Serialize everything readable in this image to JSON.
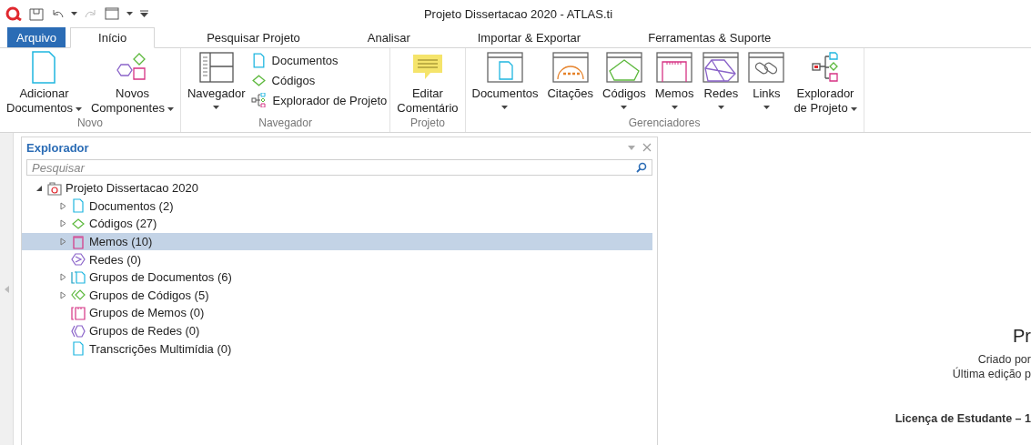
{
  "window": {
    "title": "Projeto Dissertacao 2020 - ATLAS.ti"
  },
  "tabs": [
    {
      "label": "Arquivo",
      "kind": "file",
      "selected": false
    },
    {
      "label": "Início",
      "kind": "tab",
      "selected": true
    },
    {
      "label": "Pesquisar Projeto",
      "kind": "tab",
      "selected": false
    },
    {
      "label": "Analisar",
      "kind": "tab",
      "selected": false
    },
    {
      "label": "Importar & Exportar",
      "kind": "tab",
      "selected": false
    },
    {
      "label": "Ferramentas & Suporte",
      "kind": "tab",
      "selected": false
    }
  ],
  "ribbon": [
    {
      "label": "Novo",
      "buttons": [
        {
          "kind": "document",
          "lines": [
            "Adicionar",
            "Documentos"
          ],
          "dropdown": true
        },
        {
          "kind": "components",
          "lines": [
            "Novos",
            "Componentes"
          ],
          "dropdown": true
        }
      ]
    },
    {
      "label": "Navegador",
      "buttons": [
        {
          "kind": "navigator",
          "lines": [
            "Navegador"
          ],
          "dropdown": true
        }
      ],
      "small_buttons": [
        {
          "kind": "document",
          "label": "Documentos"
        },
        {
          "kind": "code",
          "label": "Códigos"
        },
        {
          "kind": "explorer",
          "label": "Explorador de Projeto"
        }
      ]
    },
    {
      "label": "Projeto",
      "buttons": [
        {
          "kind": "comment",
          "lines": [
            "Editar",
            "Comentário"
          ],
          "dropdown": false
        }
      ]
    },
    {
      "label": "Gerenciadores",
      "buttons": [
        {
          "kind": "mgr-document",
          "lines": [
            "Documentos"
          ],
          "dropdown": true
        },
        {
          "kind": "mgr-quote",
          "lines": [
            "Citações"
          ],
          "dropdown": false
        },
        {
          "kind": "mgr-code",
          "lines": [
            "Códigos"
          ],
          "dropdown": true
        },
        {
          "kind": "mgr-memo",
          "lines": [
            "Memos"
          ],
          "dropdown": true
        },
        {
          "kind": "mgr-network",
          "lines": [
            "Redes"
          ],
          "dropdown": true
        },
        {
          "kind": "mgr-link",
          "lines": [
            "Links"
          ],
          "dropdown": true
        },
        {
          "kind": "explorer",
          "lines": [
            "Explorador",
            "de Projeto"
          ],
          "dropdown": true
        }
      ]
    }
  ],
  "explorer": {
    "title": "Explorador",
    "search": {
      "placeholder": "Pesquisar"
    },
    "tree": [
      {
        "label": "Projeto Dissertacao 2020",
        "kind": "project",
        "expanded": true,
        "expandable": true,
        "selected": false,
        "children": [
          {
            "label": "Documentos (2)",
            "kind": "document",
            "expanded": false,
            "selected": false,
            "expandable": true
          },
          {
            "label": "Códigos (27)",
            "kind": "code",
            "expanded": false,
            "selected": false,
            "expandable": true
          },
          {
            "label": "Memos (10)",
            "kind": "memo",
            "expanded": false,
            "selected": true,
            "expandable": true
          },
          {
            "label": "Redes (0)",
            "kind": "network",
            "expanded": false,
            "selected": false,
            "expandable": false
          },
          {
            "label": "Grupos de Documentos (6)",
            "kind": "docgroup",
            "expanded": false,
            "selected": false,
            "expandable": true
          },
          {
            "label": "Grupos de Códigos (5)",
            "kind": "codegroup",
            "expanded": false,
            "selected": false,
            "expandable": true
          },
          {
            "label": "Grupos de Memos (0)",
            "kind": "memogroup",
            "expanded": false,
            "selected": false,
            "expandable": false
          },
          {
            "label": "Grupos de Redes (0)",
            "kind": "netgroup",
            "expanded": false,
            "selected": false,
            "expandable": false
          },
          {
            "label": "Transcrições Multimídia (0)",
            "kind": "document",
            "expanded": false,
            "selected": false,
            "expandable": false
          }
        ]
      }
    ]
  },
  "project_info": {
    "title": "Pr",
    "created": "Criado por",
    "edited": "Última edição p",
    "license": "Licença de Estudante – 1"
  }
}
